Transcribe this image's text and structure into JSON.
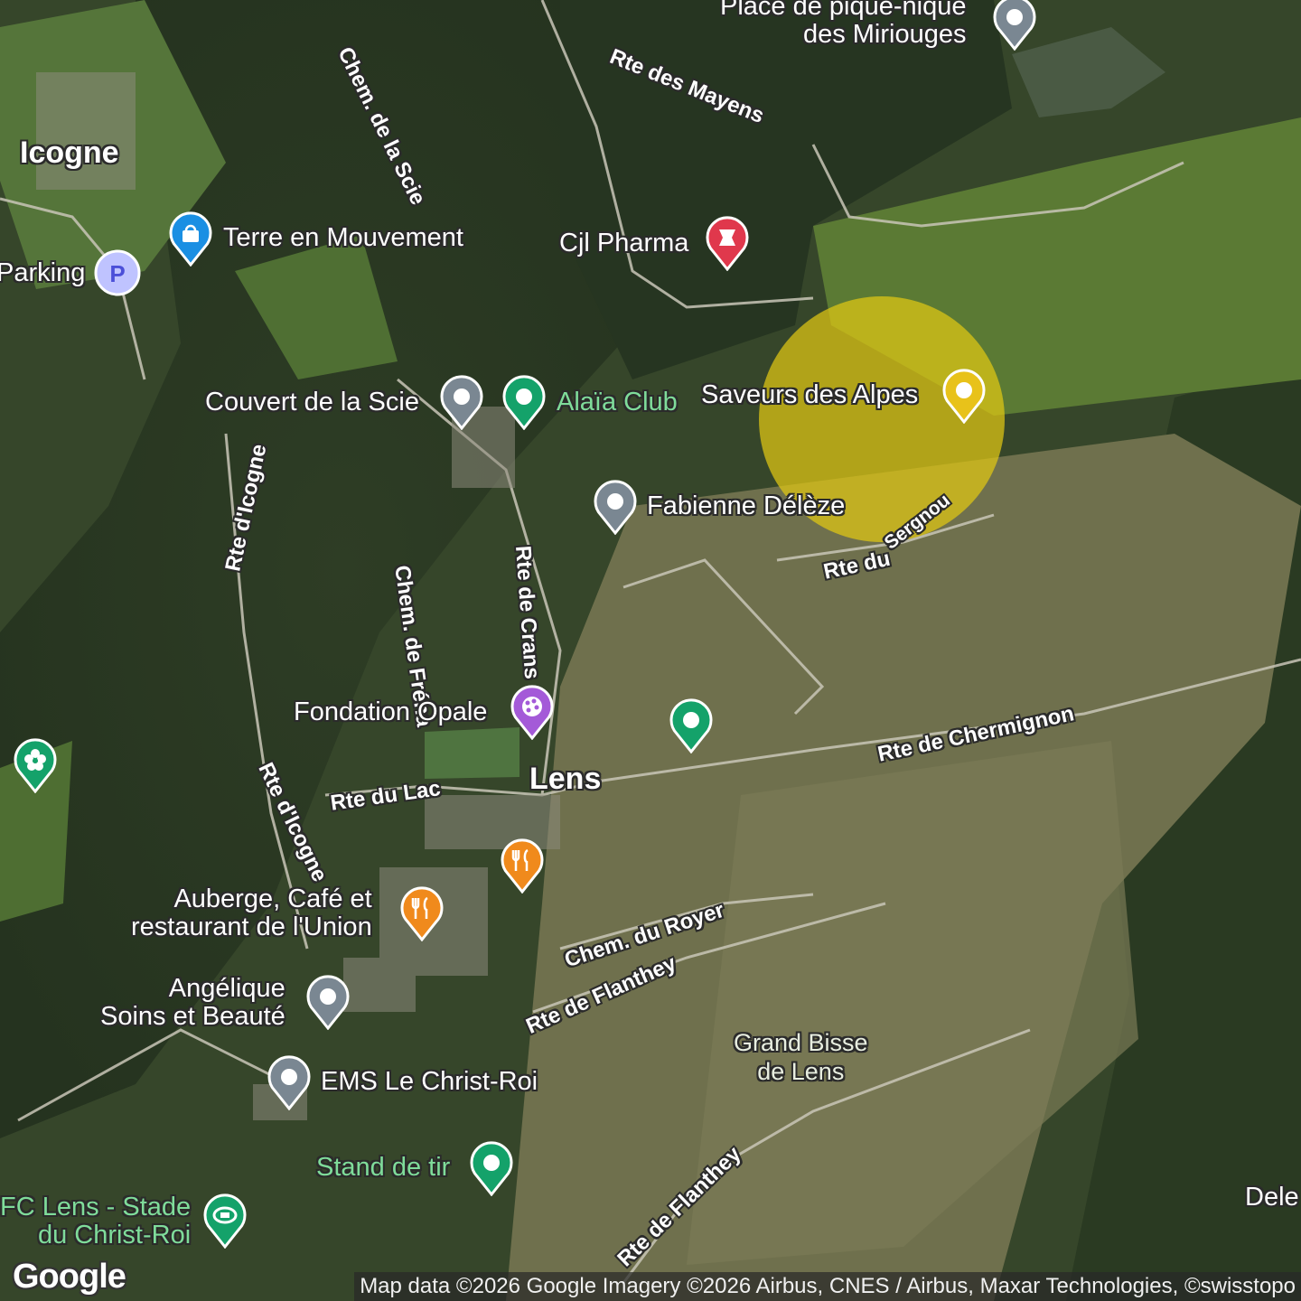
{
  "map": {
    "places": {
      "icogne": "Icogne",
      "lens": "Lens",
      "dele": "Dele"
    },
    "roads": {
      "chem_scie": "Chem. de la Scie",
      "rte_mayens": "Rte des Mayens",
      "rte_icogne_1": "Rte d'Icogne",
      "rte_icogne_2": "Rte d'Icogne",
      "chem_freha": "Chem. de Fréha",
      "rte_crans": "Rte de Crans",
      "rte_sergnou_a": "Rte du",
      "rte_sergnou_b": "Sergnou",
      "rte_chermignon": "Rte de Chermignon",
      "rte_lac": "Rte du Lac",
      "chem_royer": "Chem. du Royer",
      "rte_flanthey_1": "Rte de Flanthey",
      "rte_flanthey_2": "Rte de Flanthey"
    },
    "pois": [
      {
        "id": "place-pique-nique",
        "label": "Place de pique-nique\ndes Miriouges",
        "icon": "generic-pin-icon",
        "color": "#7a8792"
      },
      {
        "id": "terre-en-mouvement",
        "label": "Terre en Mouvement",
        "icon": "shopping-bag-icon",
        "color": "#1a8fe3"
      },
      {
        "id": "parking",
        "label": "Parking",
        "icon": "parking-icon",
        "color": "#7b7ff0"
      },
      {
        "id": "cjl-pharma",
        "label": "Cjl Pharma",
        "icon": "pharmacy-icon",
        "color": "#e0384c"
      },
      {
        "id": "couvert-scie",
        "label": "Couvert de la Scie",
        "icon": "generic-pin-icon",
        "color": "#7a8792"
      },
      {
        "id": "alaia-club",
        "label": "Alaïa Club",
        "icon": "generic-pin-icon",
        "color": "#14a26a"
      },
      {
        "id": "saveurs-alpes",
        "label": "Saveurs des Alpes",
        "icon": "generic-pin-icon",
        "color": "#e8c21a"
      },
      {
        "id": "fabienne-deleze",
        "label": "Fabienne Délèze",
        "icon": "generic-pin-icon",
        "color": "#7a8792"
      },
      {
        "id": "fondation-opale",
        "label": "Fondation Opale",
        "icon": "palette-icon",
        "color": "#a45ad8"
      },
      {
        "id": "green-unnamed",
        "label": "",
        "icon": "generic-pin-icon",
        "color": "#14a26a"
      },
      {
        "id": "flower-pin",
        "label": "",
        "icon": "flower-icon",
        "color": "#14a26a"
      },
      {
        "id": "restaurant-unnamed",
        "label": "",
        "icon": "fork-knife-icon",
        "color": "#f08a1c"
      },
      {
        "id": "auberge-union",
        "label": "Auberge, Café et\nrestaurant de l'Union",
        "icon": "fork-knife-icon",
        "color": "#f08a1c"
      },
      {
        "id": "angelique",
        "label": "Angélique\nSoins et Beauté",
        "icon": "generic-pin-icon",
        "color": "#7a8792"
      },
      {
        "id": "ems-christ-roi",
        "label": "EMS Le Christ-Roi",
        "icon": "generic-pin-icon",
        "color": "#7a8792"
      },
      {
        "id": "stand-de-tir",
        "label": "Stand de tir",
        "icon": "generic-pin-icon",
        "color": "#14a26a"
      },
      {
        "id": "fc-lens",
        "label": "FC Lens - Stade\ndu Christ-Roi",
        "icon": "stadium-icon",
        "color": "#14a26a"
      }
    ],
    "landmarks": {
      "grand_bisse": "Grand Bisse\nde Lens"
    },
    "attribution": "Map data ©2026 Google Imagery ©2026 Airbus, CNES / Airbus, Maxar Technologies, ©swisstopo",
    "logo": "Google"
  }
}
